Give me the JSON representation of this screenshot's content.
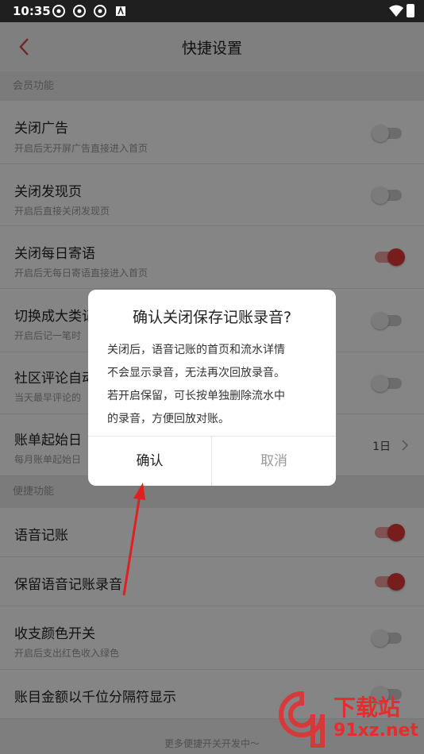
{
  "status_bar": {
    "time": "10:35"
  },
  "header": {
    "title": "快捷设置"
  },
  "sections": {
    "member": "会员功能",
    "quick": "便捷功能"
  },
  "rows": [
    {
      "label": "关闭广告",
      "desc": "开启后无开屏广告直接进入首页",
      "on": false
    },
    {
      "label": "关闭发现页",
      "desc": "开启后直接关闭发现页",
      "on": false
    },
    {
      "label": "关闭每日寄语",
      "desc": "开启后无每日寄语直接进入首页",
      "on": true
    },
    {
      "label": "切换成大类记",
      "desc": "开启后记一笔时",
      "on": false
    },
    {
      "label": "社区评论自动",
      "desc": "当天最早评论的",
      "on": false
    },
    {
      "label": "账单起始日",
      "desc": "每月账单起始日",
      "value": "1日"
    },
    {
      "label": "语音记账",
      "desc": "",
      "on": true
    },
    {
      "label": "保留语音记账录音",
      "desc": "",
      "on": true
    },
    {
      "label": "收支颜色开关",
      "desc": "开启后支出红色收入绿色",
      "on": false
    },
    {
      "label": "账目金额以千位分隔符显示",
      "desc": "",
      "on": false
    }
  ],
  "footer": "更多便捷开关开发中～",
  "dialog": {
    "title": "确认关闭保存记账录音?",
    "body_lines": [
      "关闭后，语音记账的首页和流水详情",
      "不会显示录音，无法再次回放录音。",
      "若开启保留，可长按单独删除流水中",
      "的录音，方便回放对账。"
    ],
    "confirm": "确认",
    "cancel": "取消"
  },
  "watermark": {
    "text": "下载站",
    "url": "91xz.net"
  },
  "colors": {
    "accent": "#e53935",
    "toggle_off": "#cfcfcf"
  }
}
